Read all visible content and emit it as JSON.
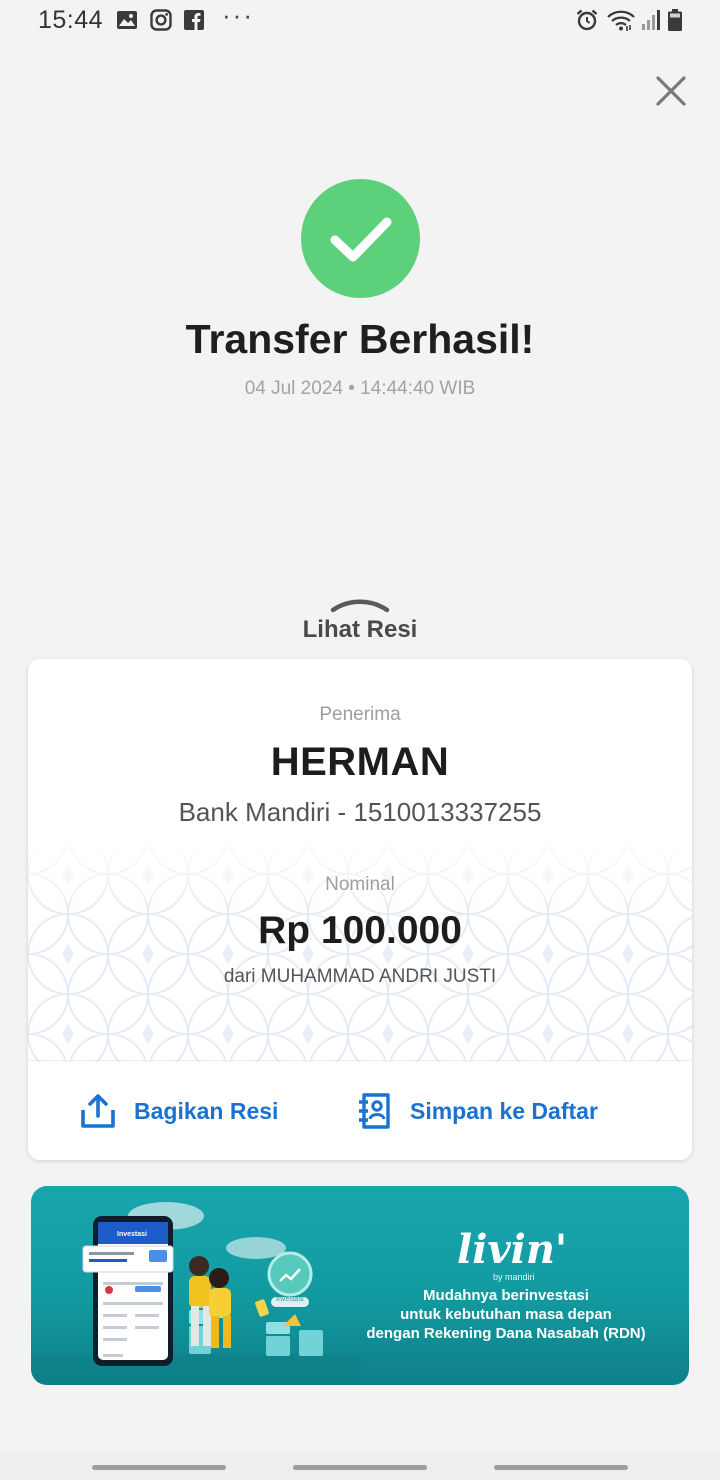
{
  "status_bar": {
    "time": "15:44",
    "left_icons": [
      "gallery-icon",
      "instagram-icon",
      "facebook-icon"
    ],
    "more": "···",
    "right_icons": [
      "alarm-icon",
      "wifi-icon",
      "signal-icon",
      "battery-icon"
    ]
  },
  "header": {
    "close_icon": "close-icon"
  },
  "success": {
    "icon": "check-icon",
    "color": "#5cd07a",
    "title": "Transfer Berhasil!",
    "datetime": "04 Jul 2024 • 14:44:40 WIB"
  },
  "receipt_toggle": {
    "label": "Lihat Resi",
    "icon": "chevron-up-icon"
  },
  "receipt": {
    "recipient_label": "Penerima",
    "recipient_name": "HERMAN",
    "recipient_bank": "Bank Mandiri - 1510013337255",
    "amount_label": "Nominal",
    "amount": "Rp 100.000",
    "sender": "dari MUHAMMAD ANDRI JUSTI",
    "actions": [
      {
        "label": "Bagikan Resi",
        "icon": "share-icon"
      },
      {
        "label": "Simpan ke Daftar",
        "icon": "save-contact-icon"
      }
    ],
    "accent_color": "#1a72d1"
  },
  "banner": {
    "logo": "livin'",
    "logo_sub": "by mandiri",
    "lines": [
      "Mudahnya berinvestasi",
      "untuk kebutuhan masa depan",
      "dengan Rekening Dana Nasabah (RDN)"
    ],
    "phone_header": "Investasi",
    "bubble_label": "Investasi"
  }
}
